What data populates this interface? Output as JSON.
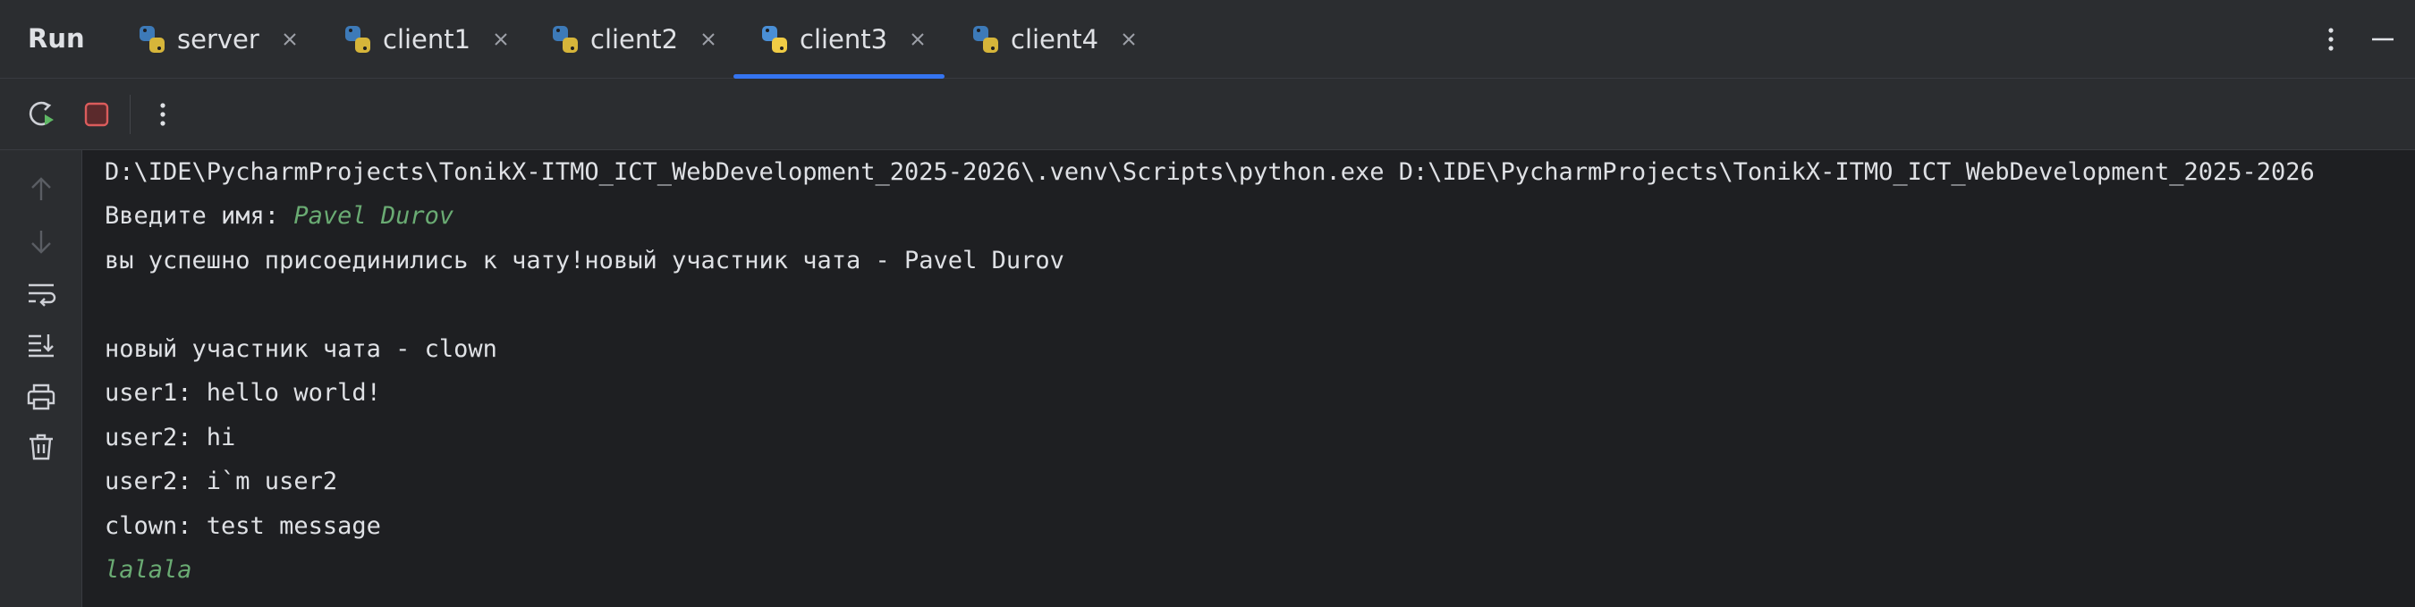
{
  "header": {
    "title": "Run",
    "tabs": [
      {
        "label": "server"
      },
      {
        "label": "client1"
      },
      {
        "label": "client2"
      },
      {
        "label": "client3",
        "active": true
      },
      {
        "label": "client4"
      }
    ]
  },
  "console": {
    "command_line": "D:\\IDE\\PycharmProjects\\TonikX-ITMO_ICT_WebDevelopment_2025-2026\\.venv\\Scripts\\python.exe D:\\IDE\\PycharmProjects\\TonikX-ITMO_ICT_WebDevelopment_2025-2026",
    "prompt": "Введите имя: ",
    "prompt_input": "Pavel Durov",
    "lines": [
      "вы успешно присоединились к чату!новый участник чата - Pavel Durov",
      "",
      "новый участник чата - clown",
      "user1: hello world!",
      "user2: hi",
      "user2: i`m user2",
      "clown: test message"
    ],
    "pending_input": "lalala"
  },
  "colors": {
    "accent": "#3574f0",
    "input_green": "#6aab73",
    "stop_red": "#db5c5c",
    "background": "#1e1f22",
    "panel": "#2b2d30"
  },
  "icons": {
    "tab_icon": "python-icon",
    "toolbar": [
      "rerun-icon",
      "stop-icon",
      "more-vertical-icon"
    ],
    "gutter": [
      "arrow-up-icon",
      "arrow-down-icon",
      "soft-wrap-icon",
      "scroll-to-end-icon",
      "print-icon",
      "trash-icon"
    ],
    "header_right": [
      "more-vertical-icon",
      "minimize-icon"
    ]
  }
}
